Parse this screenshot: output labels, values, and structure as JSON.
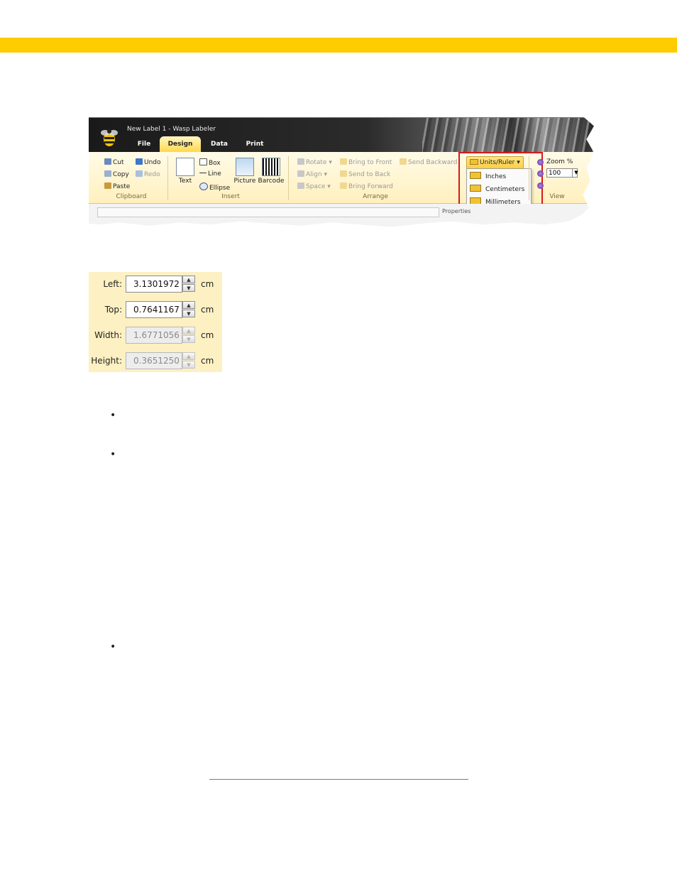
{
  "colors": {
    "accent_bar": "#ffcc00",
    "highlight_box": "#d51a1a",
    "panel_bg": "#fdf0c2"
  },
  "app": {
    "title": "New Label 1 - Wasp Labeler",
    "tabs": [
      {
        "label": "File"
      },
      {
        "label": "Design"
      },
      {
        "label": "Data"
      },
      {
        "label": "Print"
      }
    ],
    "active_tab": "Design"
  },
  "ribbon": {
    "clipboard": {
      "cut": "Cut",
      "copy": "Copy",
      "paste": "Paste",
      "undo": "Undo",
      "redo": "Redo",
      "label": "Clipboard"
    },
    "insert": {
      "text": "Text",
      "box": "Box",
      "line": "Line",
      "ellipse": "Ellipse",
      "picture": "Picture",
      "barcode": "Barcode",
      "label": "Insert"
    },
    "arrange": {
      "rotate": "Rotate",
      "align": "Align",
      "space": "Space",
      "bring_to_front": "Bring to Front",
      "send_to_back": "Send to Back",
      "bring_forward": "Bring Forward",
      "send_backward": "Send Backward",
      "label": "Arrange"
    },
    "units": {
      "button": "Units/Ruler",
      "options": [
        {
          "label": "Inches"
        },
        {
          "label": "Centimeters"
        },
        {
          "label": "Millimeters"
        }
      ]
    },
    "view": {
      "zoom_label": "Zoom %",
      "zoom_value": "100",
      "label": "View"
    },
    "properties_label": "Properties"
  },
  "properties": {
    "rows": [
      {
        "label": "Left:",
        "value": "3.1301972",
        "unit": "cm",
        "enabled": true
      },
      {
        "label": "Top:",
        "value": "0.7641167",
        "unit": "cm",
        "enabled": true
      },
      {
        "label": "Width:",
        "value": "1.6771056",
        "unit": "cm",
        "enabled": false
      },
      {
        "label": "Height:",
        "value": "0.3651250",
        "unit": "cm",
        "enabled": false
      }
    ]
  },
  "bullets": [
    "•",
    "•",
    "•"
  ]
}
